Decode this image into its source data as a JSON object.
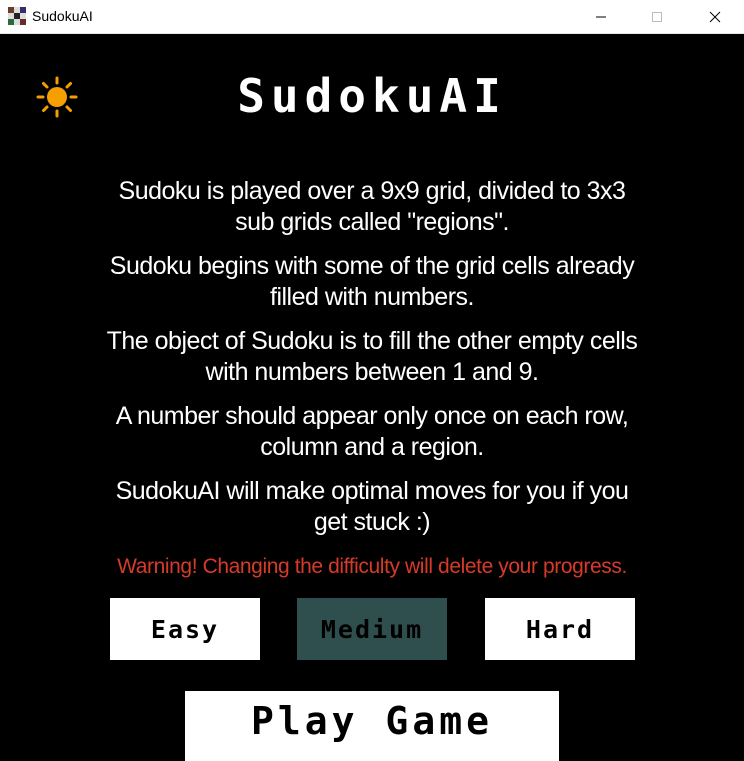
{
  "window": {
    "title": "SudokuAI",
    "icon": "sudoku-grid-icon",
    "controls": [
      "minimize-icon",
      "maximize-icon",
      "close-icon"
    ]
  },
  "theme_toggle": {
    "icon": "sun-icon",
    "color": "#f5a000"
  },
  "header": {
    "logo": "SudokuAI"
  },
  "instructions": [
    "Sudoku is played over a 9x9 grid, divided to 3x3 sub grids called \"regions\".",
    "Sudoku begins with some of the grid cells already filled with numbers.",
    "The object of Sudoku is to fill the other empty cells with numbers between 1 and 9.",
    "A number should appear only once on each row, column and a region.",
    "SudokuAI will make optimal moves for you if you get stuck :)"
  ],
  "warning": "Warning! Changing the difficulty will delete your progress.",
  "difficulty": {
    "options": [
      "Easy",
      "Medium",
      "Hard"
    ],
    "selected": "Medium",
    "selected_color": "#2f4f4f"
  },
  "play_button": "Play Game",
  "colors": {
    "background": "#000000",
    "text": "#ffffff",
    "warning": "#d83a2a"
  }
}
